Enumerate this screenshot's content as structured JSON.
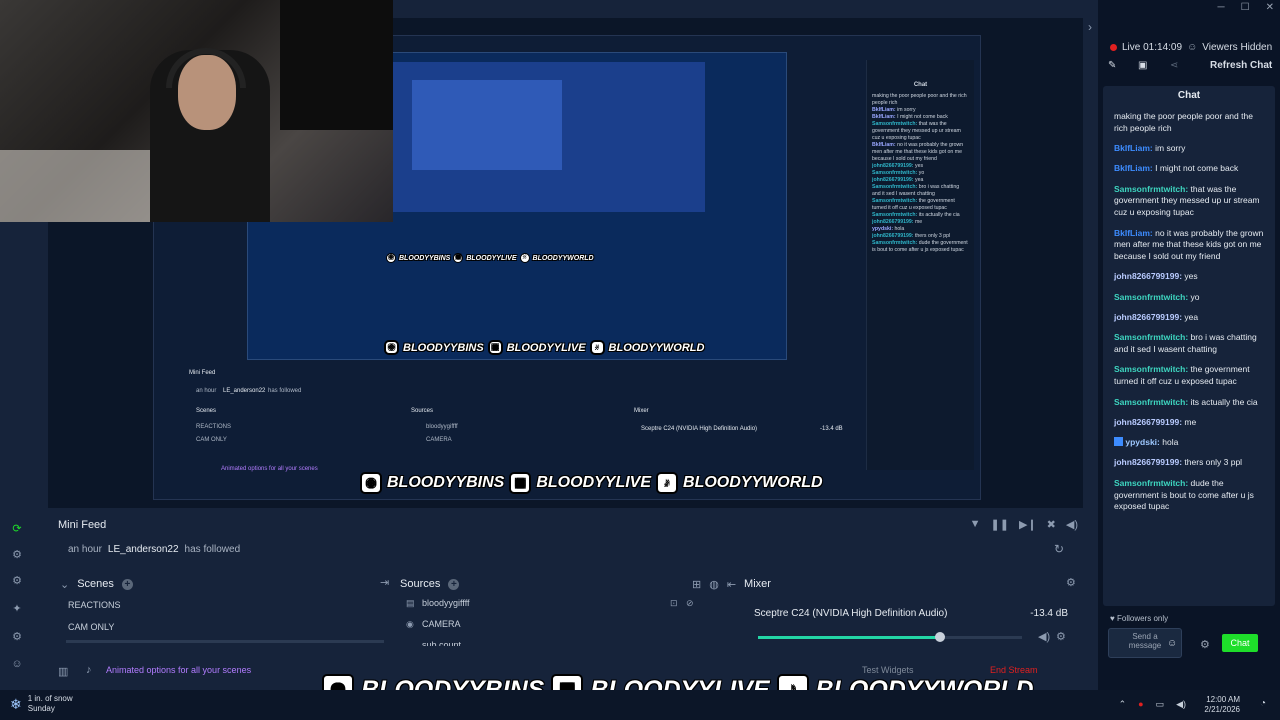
{
  "window": {
    "minimize": "─",
    "maximize": "☐",
    "close": "✕",
    "collapse_arrow": "›"
  },
  "overlay": {
    "instagram": "BLOODYYBINS",
    "twitch": "BLOODYYLIVE",
    "tiktok": "BLOODYYWORLD"
  },
  "status": {
    "live": "Live 01:14:09",
    "viewers": "Viewers Hidden"
  },
  "chat": {
    "refresh_label": "Refresh Chat",
    "title": "Chat",
    "messages": [
      {
        "user": "",
        "text": "making the poor people poor and the rich people rich"
      },
      {
        "user": "BkIfLiam:",
        "text": "im sorry"
      },
      {
        "user": "BkIfLiam:",
        "text": "I might not come back"
      },
      {
        "user": "Samsonfrmtwitch:",
        "text": "that was the government they messed up ur stream cuz u exposing tupac"
      },
      {
        "user": "BkIfLiam:",
        "text": "no it was probably the grown men after me that these kids got on me because I sold out my friend"
      },
      {
        "user": "john8266799199:",
        "text": "yes"
      },
      {
        "user": "Samsonfrmtwitch:",
        "text": "yo"
      },
      {
        "user": "john8266799199:",
        "text": "yea"
      },
      {
        "user": "Samsonfrmtwitch:",
        "text": "bro i was chatting and it sed I wasent chatting"
      },
      {
        "user": "Samsonfrmtwitch:",
        "text": "the government turned it off cuz u exposed tupac"
      },
      {
        "user": "Samsonfrmtwitch:",
        "text": "its actually the cia"
      },
      {
        "user": "john8266799199:",
        "text": "me"
      },
      {
        "user": "ypydski:",
        "text": "hola"
      },
      {
        "user": "john8266799199:",
        "text": "thers only 3 ppl"
      },
      {
        "user": "Samsonfrmtwitch:",
        "text": "dude the government is bout to come after u js exposed tupac"
      }
    ],
    "followers_only": "Followers only",
    "send_placeholder": "Send a message",
    "send_button": "Chat"
  },
  "dock": {
    "mini_feed_title": "Mini Feed",
    "feed_time": "an hour",
    "feed_user": "LE_anderson22",
    "feed_action": "has followed",
    "scenes_title": "Scenes",
    "scenes": [
      "REACTIONS",
      "CAM ONLY"
    ],
    "sources_title": "Sources",
    "sources": [
      "bloodyygiffff",
      "CAMERA",
      "sub count"
    ],
    "mixer_title": "Mixer",
    "mixer_device": "Sceptre C24 (NVIDIA High Definition Audio)",
    "mixer_level": "-13.4 dB",
    "mixer_volume_fraction": 0.69,
    "promo": "Animated options for all your scenes",
    "test_widgets": "Test Widgets",
    "end_stream": "End Stream"
  },
  "taskbar": {
    "weather_temp": "1 in. of snow",
    "weather_day": "Sunday",
    "time": "12:00 AM",
    "date": "2/21/2026"
  },
  "nested": {
    "chat_title": "Chat",
    "mini_feed": "Mini Feed",
    "feed_user": "LE_anderson22",
    "feed_action": "has followed",
    "feed_time": "an hour",
    "scenes": "Scenes",
    "sources": "Sources",
    "mixer": "Mixer",
    "reactions": "REACTIONS",
    "cam_only": "CAM ONLY",
    "source1": "bloodyygiffff",
    "source2": "CAMERA",
    "mixer_device": "Sceptre C24 (NVIDIA High Definition Audio)",
    "mixer_level": "-13.4 dB",
    "promo": "Animated options for all your scenes"
  },
  "colors": {
    "accent_green": "#1ede2a",
    "live_red": "#e02020",
    "promo_purple": "#b27cff"
  }
}
